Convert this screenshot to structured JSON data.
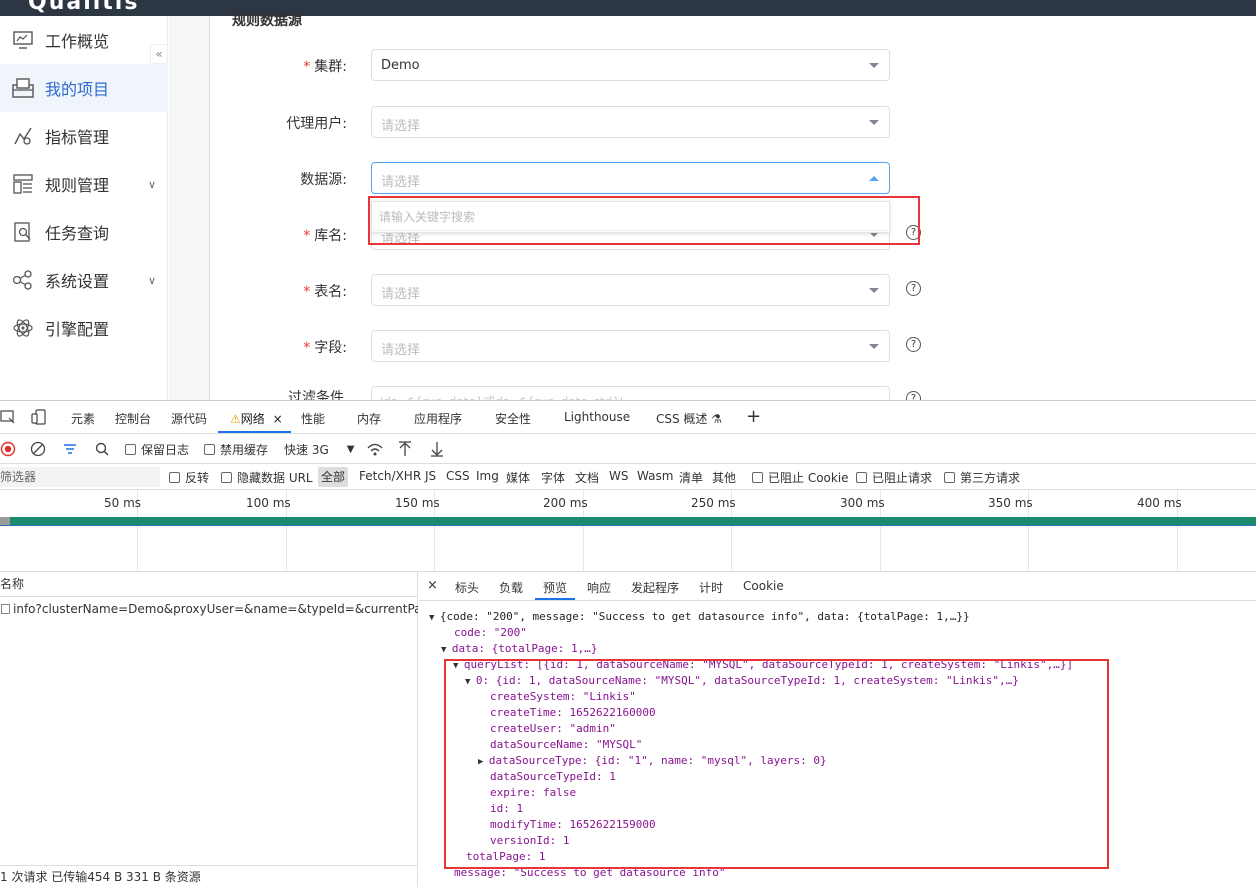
{
  "app": {
    "logo": "Qualitis",
    "section_title": "规则数据源",
    "sidebar": {
      "collapse": "«",
      "items": [
        {
          "label": "工作概览",
          "icon": "monitor-icon"
        },
        {
          "label": "我的项目",
          "icon": "project-icon"
        },
        {
          "label": "指标管理",
          "icon": "metric-icon"
        },
        {
          "label": "规则管理",
          "icon": "rule-icon",
          "arrow": "∨"
        },
        {
          "label": "任务查询",
          "icon": "task-search-icon"
        },
        {
          "label": "系统设置",
          "icon": "settings-icon",
          "arrow": "∨"
        },
        {
          "label": "引擎配置",
          "icon": "engine-icon"
        }
      ]
    },
    "form": {
      "cluster": {
        "label": "集群:",
        "value": "Demo"
      },
      "proxy_user": {
        "label": "代理用户:",
        "placeholder": "请选择"
      },
      "datasource": {
        "label": "数据源:",
        "placeholder": "请选择",
        "search_placeholder": "请输入关键字搜索"
      },
      "db": {
        "label": "库名:",
        "placeholder": "请选择"
      },
      "table": {
        "label": "表名:",
        "placeholder": "请选择"
      },
      "field": {
        "label": "字段:",
        "placeholder": "请选择"
      },
      "filter": {
        "label": "过滤条件",
        "value": "'ds=${run_date}或ds=${run_date_std}'"
      },
      "help": "?"
    }
  },
  "devtools": {
    "tabs": [
      "元素",
      "控制台",
      "源代码",
      "网络",
      "性能",
      "内存",
      "应用程序",
      "安全性",
      "Lighthouse",
      "CSS 概述"
    ],
    "active_tab_close": "×",
    "toolbar": {
      "preserve_log": "保留日志",
      "disable_cache": "禁用缓存",
      "throttle": "快速 3G"
    },
    "filterbar": {
      "filter_placeholder": "筛选器",
      "invert": "反转",
      "hide_data_url": "隐藏数据 URL",
      "all": "全部",
      "types": [
        "Fetch/XHR",
        "JS",
        "CSS",
        "Img",
        "媒体",
        "字体",
        "文档",
        "WS",
        "Wasm",
        "清单",
        "其他"
      ],
      "blocked_cookies": "已阻止 Cookie",
      "blocked_requests": "已阻止请求",
      "third_party": "第三方请求"
    },
    "timeline_ticks": [
      "50 ms",
      "100 ms",
      "150 ms",
      "200 ms",
      "250 ms",
      "300 ms",
      "350 ms",
      "400 ms"
    ],
    "requests": {
      "header": "名称",
      "rows": [
        "info?clusterName=Demo&proxyUser=&name=&typeId=&currentPage=..."
      ],
      "footer": "1 次请求  已传输454 B  331 B 条资源"
    },
    "detail_tabs": [
      "×",
      "标头",
      "负载",
      "预览",
      "响应",
      "发起程序",
      "计时",
      "Cookie"
    ],
    "preview": {
      "lines": [
        "{code: \"200\", message: \"Success to get datasource info\", data: {totalPage: 1,…}}",
        "code: \"200\"",
        "data: {totalPage: 1,…}",
        "queryList: [{id: 1, dataSourceName: \"MYSQL\", dataSourceTypeId: 1, createSystem: \"Linkis\",…}]",
        "0: {id: 1, dataSourceName: \"MYSQL\", dataSourceTypeId: 1, createSystem: \"Linkis\",…}",
        "createSystem: \"Linkis\"",
        "createTime: 1652622160000",
        "createUser: \"admin\"",
        "dataSourceName: \"MYSQL\"",
        "dataSourceType: {id: \"1\", name: \"mysql\", layers: 0}",
        "dataSourceTypeId: 1",
        "expire: false",
        "id: 1",
        "modifyTime: 1652622159000",
        "versionId: 1",
        "totalPage: 1",
        "message: \"Success to get datasource info\""
      ]
    }
  },
  "colors": {
    "accent": "#2d6bd2",
    "highlight_box": "#e8343b",
    "active_tab": "#1a73e8"
  }
}
